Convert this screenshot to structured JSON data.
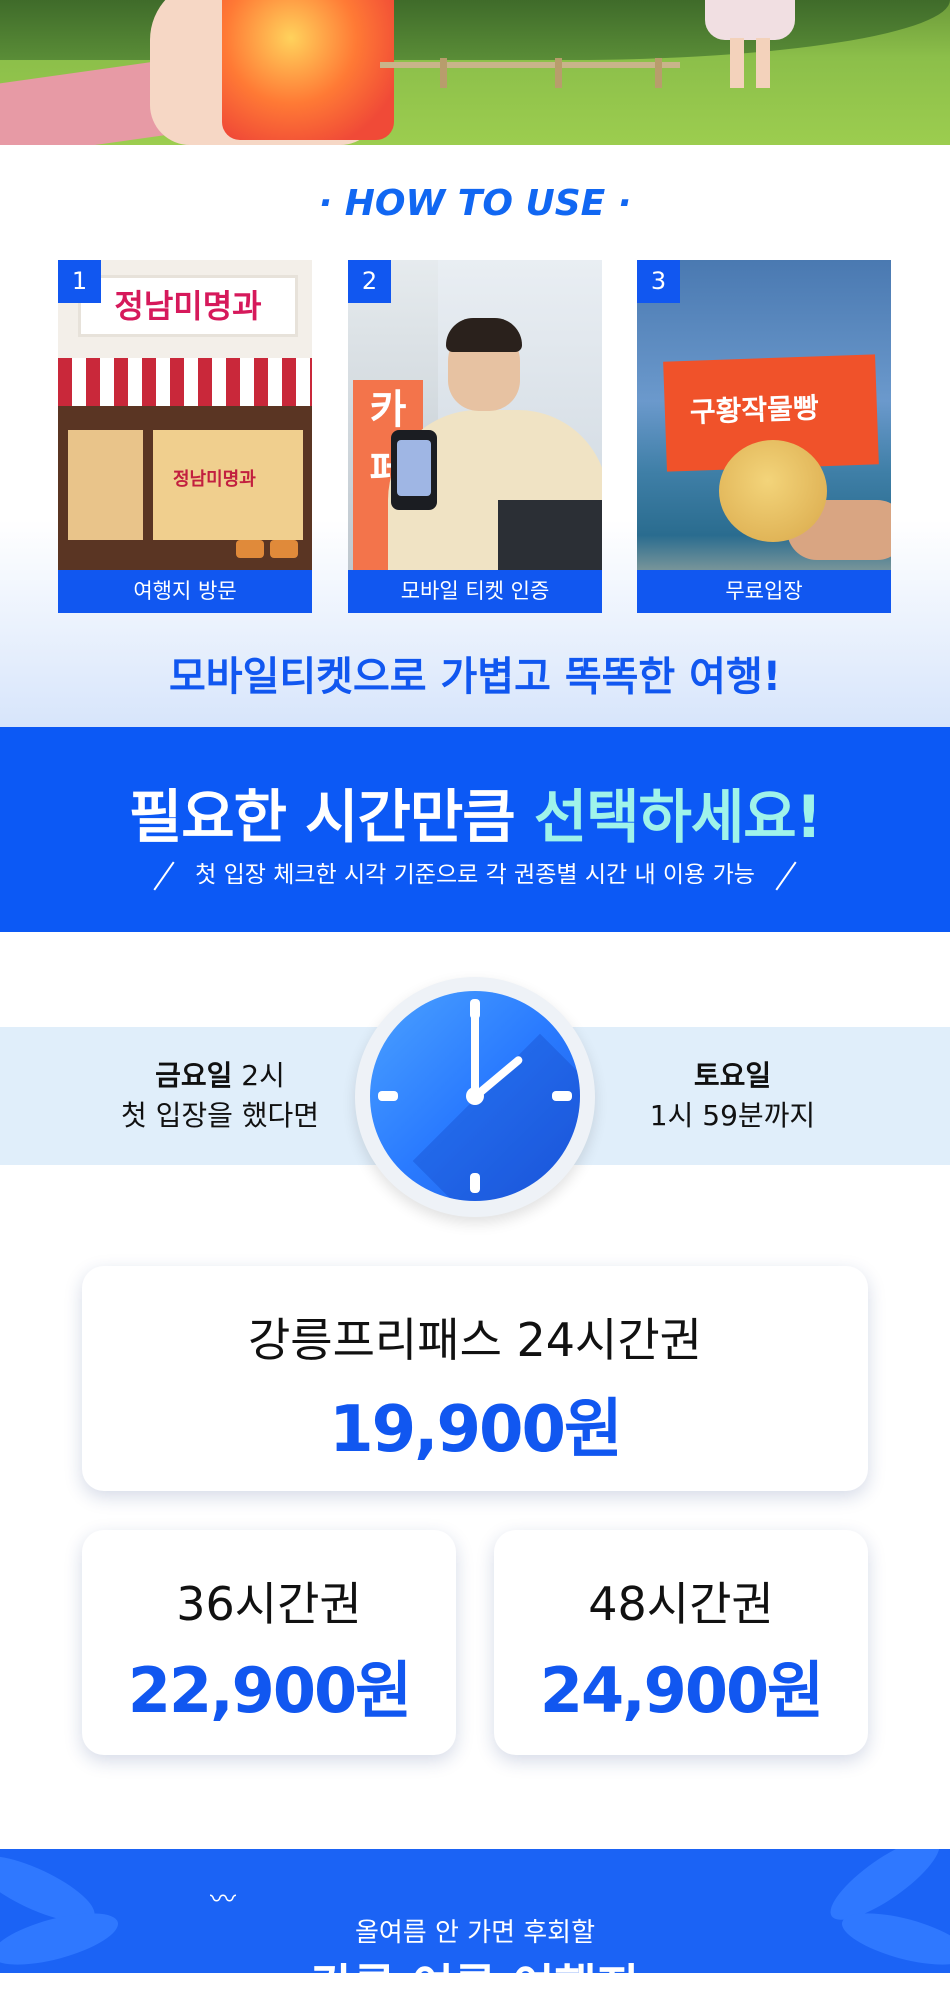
{
  "hero": {
    "alt": "강릉 여행 사진"
  },
  "howto": {
    "title": "· HOW TO USE ·",
    "steps": [
      {
        "num": "1",
        "label": "여행지 방문",
        "sign": "정남미명과"
      },
      {
        "num": "2",
        "label": "모바일 티켓 인증",
        "banner": "카페"
      },
      {
        "num": "3",
        "label": "무료입장",
        "box": "구황작물빵"
      }
    ],
    "tagline": "모바일티켓으로 가볍고 똑똑한 여행!"
  },
  "band": {
    "title_a": "필요한 시간만큼 ",
    "title_b": "선택하세요!",
    "subtitle": "첫 입장 체크한 시각 기준으로 각 권종별 시간 내 이용 가능"
  },
  "example": {
    "left_bold": "금요일",
    "left_rest": " 2시",
    "left_line2": "첫 입장을 했다면",
    "right_bold": "토요일",
    "right_line2": "1시 59분까지"
  },
  "prices": [
    {
      "name": "강릉프리패스 24시간권",
      "price": "19,900원"
    },
    {
      "name": "36시간권",
      "price": "22,900원"
    },
    {
      "name": "48시간권",
      "price": "24,900원"
    }
  ],
  "bottom": {
    "subtitle": "올여름 안 가면 후회할",
    "title": "강릉 여름 여행지"
  },
  "colors": {
    "brand_blue": "#1157f0",
    "band_blue": "#0c59f5",
    "accent_mint": "#9ff3ea",
    "strip_bg": "#e0eefa"
  }
}
